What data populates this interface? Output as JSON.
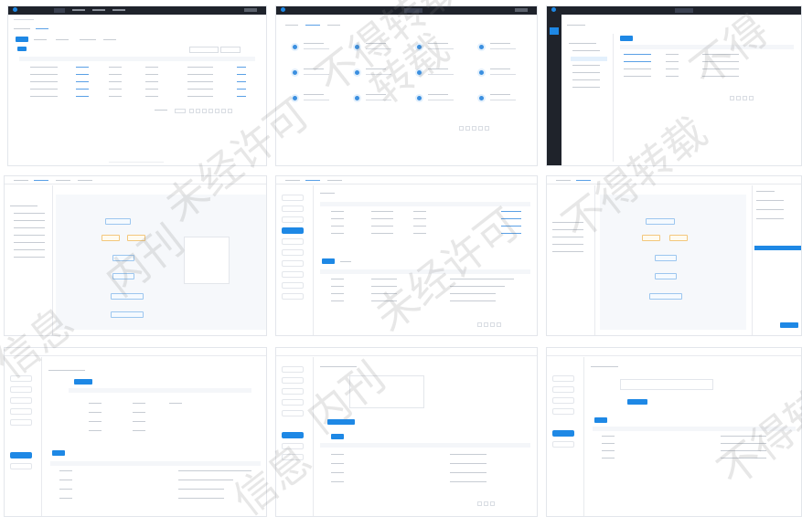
{
  "watermark": {
    "texts": [
      "不得转载",
      "未经许可",
      "内刊",
      "信息",
      "不得转载",
      "不得",
      "未经许可",
      "内刊",
      "信息",
      "不得转载",
      "转载"
    ]
  },
  "app": {
    "brand_name": "",
    "accent_color": "#1e88e5",
    "dark_color": "#1f232b"
  }
}
